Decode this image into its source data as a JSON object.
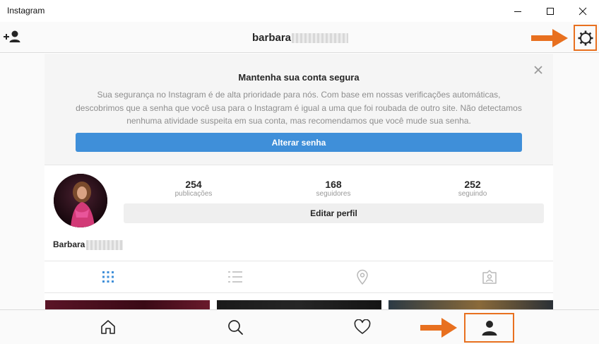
{
  "window": {
    "title": "Instagram"
  },
  "header": {
    "username": "barbara"
  },
  "security_alert": {
    "title": "Mantenha sua conta segura",
    "body": "Sua segurança no Instagram é de alta prioridade para nós. Com base em nossas verificações automáticas, descobrimos que a senha que você usa para o Instagram é igual a uma que foi roubada de outro site. Não detectamos nenhuma atividade suspeita em sua conta, mas recomendamos que você mude sua senha.",
    "button_label": "Alterar senha"
  },
  "profile": {
    "stats": [
      {
        "value": "254",
        "label": "publicações"
      },
      {
        "value": "168",
        "label": "seguidores"
      },
      {
        "value": "252",
        "label": "seguindo"
      }
    ],
    "edit_label": "Editar perfil",
    "full_name": "Barbara"
  },
  "tabs": [
    "grid-icon",
    "list-icon",
    "location-pin-icon",
    "tagged-photos-icon"
  ],
  "bottom_nav": [
    "home-icon",
    "search-icon",
    "heart-icon",
    "profile-icon"
  ],
  "colors": {
    "accent_blue": "#3f8fd9",
    "highlight_orange": "#e8701f",
    "text_dark": "#262626",
    "text_muted": "#8e8e8e"
  }
}
